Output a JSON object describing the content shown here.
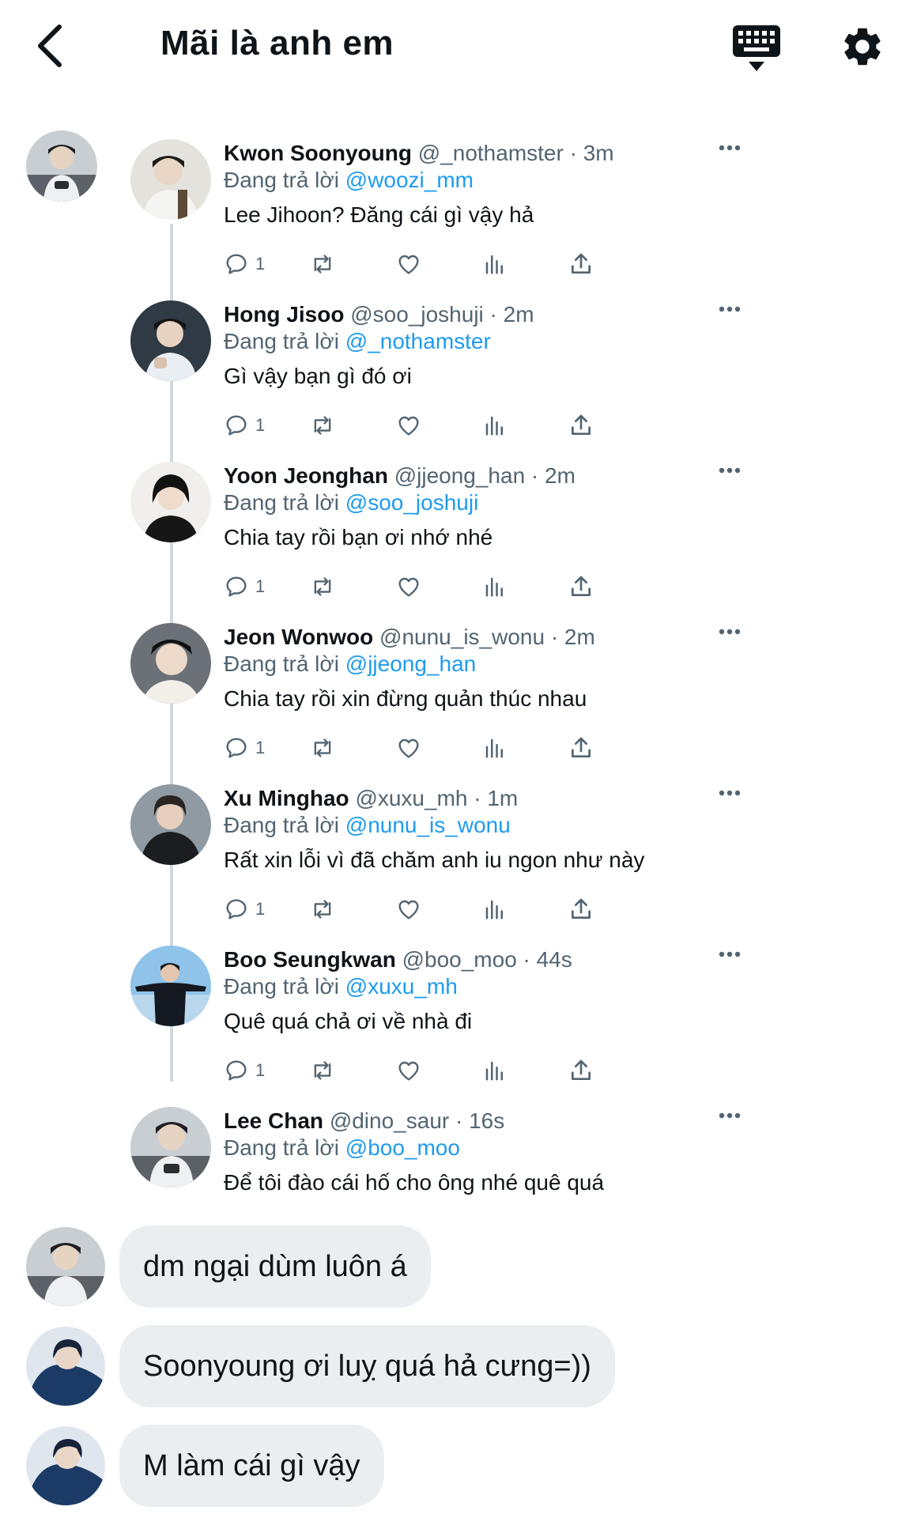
{
  "header": {
    "title": "Mãi là anh em",
    "back_icon": "back-chevron-icon",
    "keyboard_icon": "keyboard-icon",
    "settings_icon": "gear-icon"
  },
  "colors": {
    "link": "#1d9bf0",
    "muted": "#536471",
    "text": "#0f1419",
    "bubble": "#ebeef0",
    "thread_line": "#cfd9de"
  },
  "tweets": [
    {
      "name": "Kwon Soonyoung",
      "meta": "@_nothamster · 3m",
      "reply_prefix": "Đang trả lời",
      "reply_to": "@woozi_mm",
      "text": "Lee Jihoon? Đăng cái gì vậy hả",
      "replies": "1"
    },
    {
      "name": "Hong Jisoo",
      "meta": "@soo_joshuji · 2m",
      "reply_prefix": "Đang trả lời",
      "reply_to": "@_nothamster",
      "text": "Gì vậy bạn gì đó ơi",
      "replies": "1"
    },
    {
      "name": "Yoon Jeonghan",
      "meta": "@jjeong_han · 2m",
      "reply_prefix": "Đang trả lời",
      "reply_to": "@soo_joshuji",
      "text": "Chia tay rồi bạn ơi nhớ nhé",
      "replies": "1"
    },
    {
      "name": "Jeon Wonwoo",
      "meta": "@nunu_is_wonu · 2m",
      "reply_prefix": "Đang trả lời",
      "reply_to": "@jjeong_han",
      "text": "Chia tay rồi xin đừng quản thúc nhau",
      "replies": "1"
    },
    {
      "name": "Xu Minghao",
      "meta": "@xuxu_mh · 1m",
      "reply_prefix": "Đang trả lời",
      "reply_to": "@nunu_is_wonu",
      "text": "Rất xin lỗi vì đã chăm anh iu ngon như này",
      "replies": "1"
    },
    {
      "name": "Boo Seungkwan",
      "meta": "@boo_moo · 44s",
      "reply_prefix": "Đang trả lời",
      "reply_to": "@xuxu_mh",
      "text": "Quê quá chả ơi về nhà đi",
      "replies": "1"
    },
    {
      "name": "Lee Chan",
      "meta": "@dino_saur · 16s",
      "reply_prefix": "Đang trả lời",
      "reply_to": "@boo_moo",
      "text": "Để tôi đào cái hố cho ông nhé quê quá"
    }
  ],
  "messages": [
    {
      "text": "dm ngại dùm luôn á"
    },
    {
      "text": "Soonyoung ơi luỵ quá hả cưng=))"
    },
    {
      "text": "M làm cái gì vậy"
    }
  ]
}
